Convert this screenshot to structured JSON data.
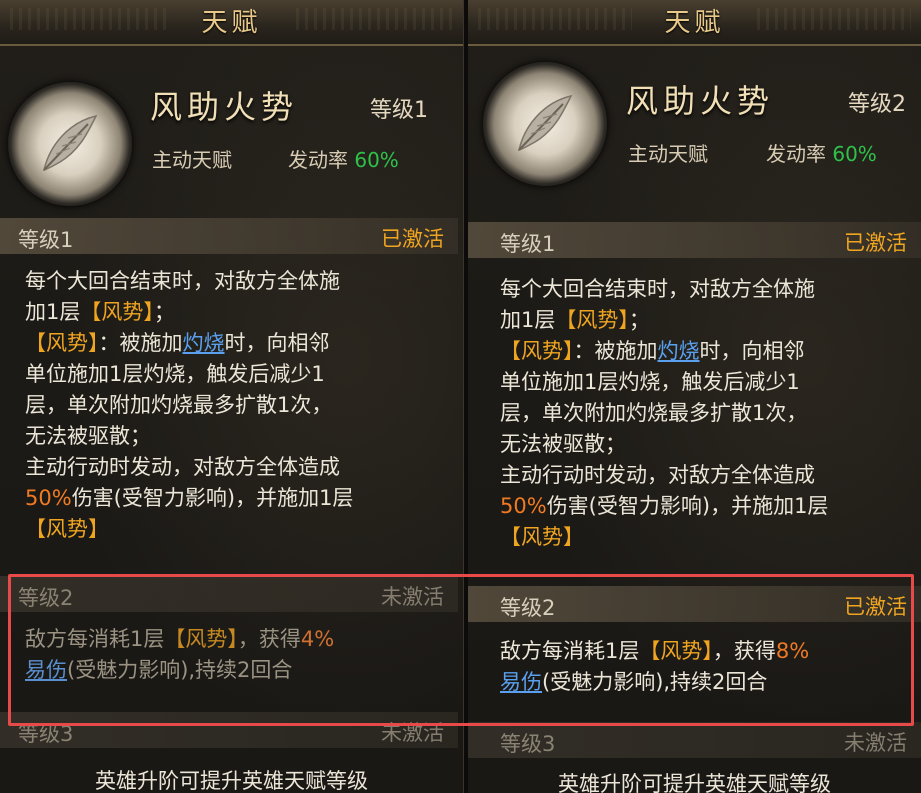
{
  "panels": [
    {
      "title": "天赋",
      "skill": {
        "icon": "feather-icon",
        "name": "风助火势",
        "level": "等级1",
        "type": "主动天赋",
        "trigger_label": "发动率",
        "trigger_rate": "60%"
      },
      "levels": [
        {
          "level": "等级1",
          "status": "已激活",
          "lines": [
            [
              {
                "t": "每个大回合结束时，对敌方全体施"
              }
            ],
            [
              {
                "t": "加1层"
              },
              {
                "t": "【风势】",
                "k": "kw"
              },
              {
                "t": "；"
              }
            ],
            [
              {
                "t": "【风势】",
                "k": "kw"
              },
              {
                "t": "：被施加"
              },
              {
                "t": "灼烧",
                "k": "link"
              },
              {
                "t": "时，向相邻"
              }
            ],
            [
              {
                "t": "单位施加1层灼烧，触发后减少1"
              }
            ],
            [
              {
                "t": "层，单次附加灼烧最多扩散1次，"
              }
            ],
            [
              {
                "t": "无法被驱散；"
              }
            ],
            [
              {
                "t": "主动行动时发动，对敌方全体造成"
              }
            ],
            [
              {
                "t": "50%",
                "k": "pct"
              },
              {
                "t": "伤害(受智力影响)，并施加1层"
              }
            ],
            [
              {
                "t": "【风势】",
                "k": "kw"
              }
            ]
          ]
        },
        {
          "level": "等级2",
          "status": "未激活",
          "lines": [
            [
              {
                "t": "敌方每消耗1层"
              },
              {
                "t": "【风势】",
                "k": "kw"
              },
              {
                "t": "，获得"
              },
              {
                "t": "4%",
                "k": "pct"
              }
            ],
            [
              {
                "t": "易伤",
                "k": "link"
              },
              {
                "t": "(受魅力影响),持续2回合"
              }
            ]
          ]
        },
        {
          "level": "等级3",
          "status": "未激活"
        }
      ],
      "footer": "英雄升阶可提升英雄天赋等级"
    },
    {
      "title": "天赋",
      "skill": {
        "icon": "feather-icon",
        "name": "风助火势",
        "level": "等级2",
        "type": "主动天赋",
        "trigger_label": "发动率",
        "trigger_rate": "60%"
      },
      "levels": [
        {
          "level": "等级1",
          "status": "已激活",
          "lines": [
            [
              {
                "t": "每个大回合结束时，对敌方全体施"
              }
            ],
            [
              {
                "t": "加1层"
              },
              {
                "t": "【风势】",
                "k": "kw"
              },
              {
                "t": "；"
              }
            ],
            [
              {
                "t": "【风势】",
                "k": "kw"
              },
              {
                "t": "：被施加"
              },
              {
                "t": "灼烧",
                "k": "link"
              },
              {
                "t": "时，向相邻"
              }
            ],
            [
              {
                "t": "单位施加1层灼烧，触发后减少1"
              }
            ],
            [
              {
                "t": "层，单次附加灼烧最多扩散1次，"
              }
            ],
            [
              {
                "t": "无法被驱散；"
              }
            ],
            [
              {
                "t": "主动行动时发动，对敌方全体造成"
              }
            ],
            [
              {
                "t": "50%",
                "k": "pct"
              },
              {
                "t": "伤害(受智力影响)，并施加1层"
              }
            ],
            [
              {
                "t": "【风势】",
                "k": "kw"
              }
            ]
          ]
        },
        {
          "level": "等级2",
          "status": "已激活",
          "lines": [
            [
              {
                "t": "敌方每消耗1层"
              },
              {
                "t": "【风势】",
                "k": "kw"
              },
              {
                "t": "，获得"
              },
              {
                "t": "8%",
                "k": "pct"
              }
            ],
            [
              {
                "t": "易伤",
                "k": "link"
              },
              {
                "t": "(受魅力影响),持续2回合"
              }
            ]
          ]
        },
        {
          "level": "等级3",
          "status": "未激活"
        }
      ],
      "footer": "英雄升阶可提升英雄天赋等级"
    }
  ]
}
